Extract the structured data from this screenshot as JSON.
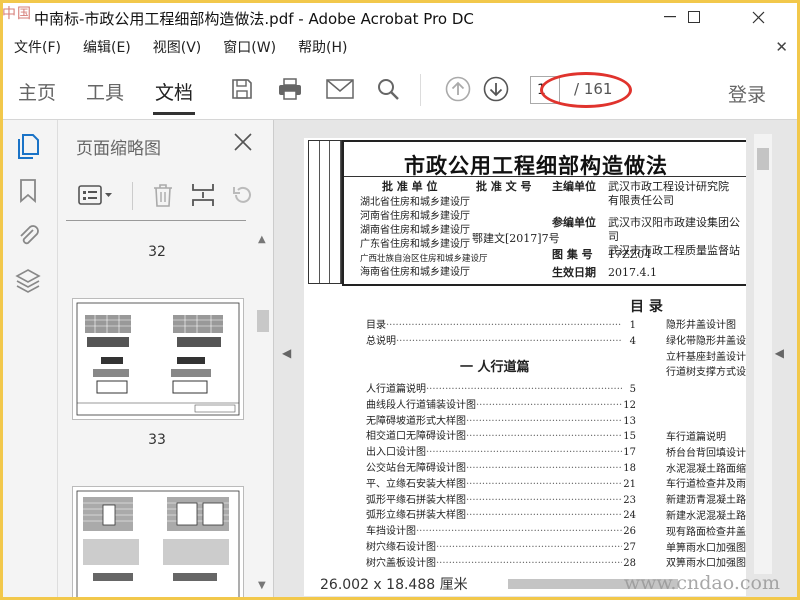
{
  "window": {
    "logo_text": "中国",
    "title": "中南标-市政公用工程细部构造做法.pdf - Adobe Acrobat Pro DC",
    "controls": [
      "—",
      "☐",
      "✕"
    ]
  },
  "menu": {
    "items": [
      "文件(F)",
      "编辑(E)",
      "视图(V)",
      "窗口(W)",
      "帮助(H)"
    ],
    "close": "✕"
  },
  "toolbar": {
    "tabs": [
      "主页",
      "工具",
      "文档"
    ],
    "active_tab": "文档",
    "page_current": "1",
    "page_total": "/ 161",
    "login": "登录",
    "highlight_color": "#e0332d"
  },
  "thumbnails_panel": {
    "title": "页面缩略图",
    "close": "✕",
    "pages": [
      "32",
      "33"
    ]
  },
  "document": {
    "size_label": "26.002 x 18.488 厘米",
    "watermark": "www.cndao.com",
    "title": "市政公用工程细部构造做法",
    "header": {
      "approval_unit_label": "批 准 单 位",
      "approval_units": [
        "湖北省住房和城乡建设厅",
        "河南省住房和城乡建设厅",
        "湖南省住房和城乡建设厅",
        "广东省住房和城乡建设厅",
        "广西壮族自治区住房和城乡建设厅",
        "海南省住房和城乡建设厅"
      ],
      "approval_doc_label": "批 准 文 号",
      "approval_doc": "鄂建文[2017]7号",
      "editor_label": "主编单位",
      "editor": [
        "武汉市政工程设计研究院",
        "有限责任公司"
      ],
      "co_editor_label": "参编单位",
      "co_editors": [
        "武汉市汉阳市政建设集团公司",
        "武汉市市政工程质量监督站"
      ],
      "atlas_no_label": "图  集  号",
      "atlas_no": "17ZZ04",
      "effective_label": "生效日期",
      "effective": "2017.4.1"
    },
    "toc_title": "目 录",
    "toc_pre": [
      {
        "t": "目录",
        "p": "1"
      },
      {
        "t": "总说明",
        "p": "4"
      }
    ],
    "section": "一 人行道篇",
    "toc_main": [
      {
        "t": "人行道篇说明",
        "p": "5"
      },
      {
        "t": "曲线段人行道铺装设计图",
        "p": "12"
      },
      {
        "t": "无障碍坡道形式大样图",
        "p": "13"
      },
      {
        "t": "相交道口无障碍设计图",
        "p": "15"
      },
      {
        "t": "出入口设计图",
        "p": "17"
      },
      {
        "t": "公交站台无障碍设计图",
        "p": "18"
      },
      {
        "t": "平、立缘石安装大样图",
        "p": "21"
      },
      {
        "t": "弧形平缘石拼装大样图",
        "p": "23"
      },
      {
        "t": "弧形立缘石拼装大样图",
        "p": "24"
      },
      {
        "t": "车挡设计图",
        "p": "26"
      },
      {
        "t": "树穴缘石设计图",
        "p": "27"
      },
      {
        "t": "树穴盖板设计图",
        "p": "28"
      }
    ],
    "toc_right_top": [
      "隐形井盖设计图",
      "绿化带隐形井盖设计",
      "立杆基座封盖设计图",
      "行道树支撑方式设计"
    ],
    "toc_right_bottom": [
      "车行道篇说明",
      "桥台台背回填设计图",
      "水泥混凝土路面缩缝",
      "车行道检查井及雨水",
      "新建沥青混凝土路面",
      "新建水泥混凝土路面",
      "现有路面检查井盖改",
      "单箅雨水口加强图",
      "双箅雨水口加强图"
    ]
  }
}
